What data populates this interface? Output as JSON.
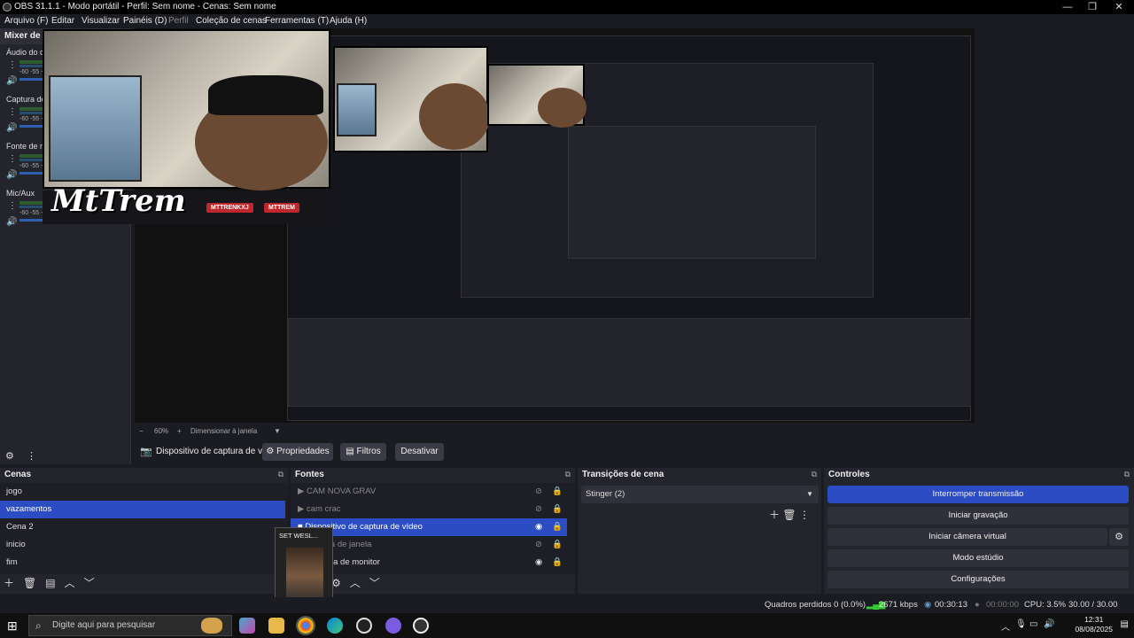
{
  "window": {
    "title": "OBS 31.1.1 - Modo portátil - Perfil: Sem nome - Cenas: Sem nome",
    "minimize": "—",
    "maximize": "❐",
    "close": "✕"
  },
  "menu": [
    "Arquivo (F)",
    "Editar",
    "Visualizar",
    "Painéis (D)",
    "Perfil",
    "Coleção de cenas",
    "Ferramentas (T)",
    "Ajuda (H)"
  ],
  "mixer": {
    "title": "Mixer de áudio",
    "channels": [
      {
        "name": "Áudio do desktop",
        "db_scale": "-60 -55 -50"
      },
      {
        "name": "Captura de áudio",
        "db_scale": "-60 -55 -50"
      },
      {
        "name": "Fonte de mídia",
        "db_scale": "-60 -55 -50"
      },
      {
        "name": "Mic/Aux",
        "db_scale": "-60 -55 -50"
      }
    ]
  },
  "overlay": {
    "logo_text": "MtTrem",
    "tag1": "MTTRENKXJ",
    "tag2": "MTTREM"
  },
  "zoom": {
    "minus": "−",
    "value": "60%",
    "plus": "+",
    "resize_label": "Dimensionar à janela"
  },
  "source_toolbar": {
    "source_name": "Dispositivo de captura de v",
    "properties": "Propriedades",
    "filters": "Filtros",
    "deactivate": "Desativar"
  },
  "scenes": {
    "title": "Cenas",
    "items": [
      "jogo",
      "vazamentos",
      "Cena 2",
      "inicio",
      "fim"
    ],
    "selected_index": 1
  },
  "sources": {
    "title": "Fontes",
    "items": [
      {
        "name": "CAM NOVA GRAV",
        "visible": false
      },
      {
        "name": "cam crac",
        "visible": false
      },
      {
        "name": "Dispositivo de captura de vídeo",
        "visible": true,
        "selected": true
      },
      {
        "name": "Captura de janela",
        "visible": false
      },
      {
        "name": "Captura de monitor",
        "visible": true
      }
    ]
  },
  "transitions": {
    "title": "Transições de cena",
    "selected": "Stinger (2)"
  },
  "controls": {
    "title": "Controles",
    "buttons": [
      "Interromper transmissão",
      "Iniciar gravação",
      "Iniciar câmera virtual",
      "Modo estúdio",
      "Configurações"
    ]
  },
  "status": {
    "dropped": "Quadros perdidos 0 (0.0%)",
    "bitrate": "2671 kbps",
    "stream_time": "00:30:13",
    "rec_time": "00:00:00",
    "cpu": "CPU: 3.5%",
    "fps": "30.00 / 30.00 FPS"
  },
  "popup": {
    "title": "SET WESL..."
  },
  "taskbar": {
    "search_placeholder": "Digite aqui para pesquisar",
    "time": "12:31",
    "date": "08/08/2025"
  },
  "colors": {
    "accent": "#2c4cc3",
    "panel": "#24252c",
    "background": "#1b1c22"
  }
}
